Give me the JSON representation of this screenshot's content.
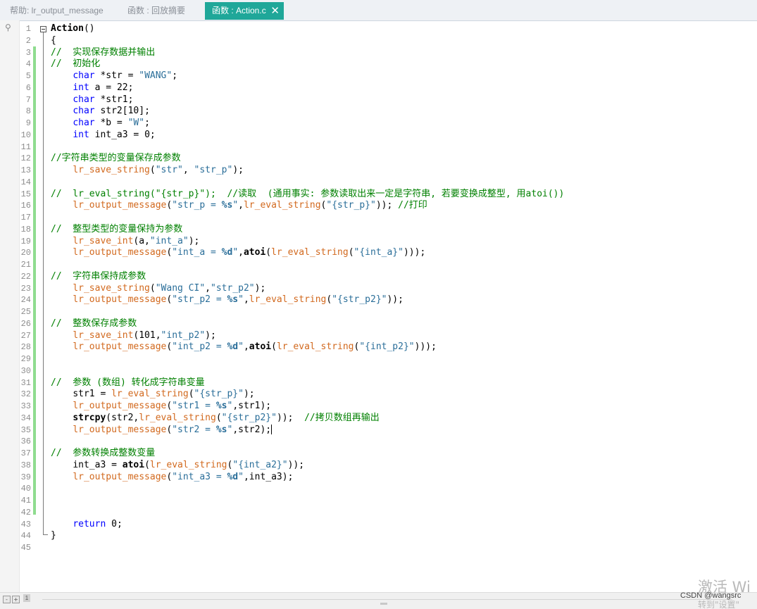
{
  "tabs": [
    {
      "label": "帮助: lr_output_message",
      "active": false
    },
    {
      "label": "函数 : 回放摘要",
      "active": false
    },
    {
      "label": "函数 : Action.c",
      "active": true
    }
  ],
  "line_numbers": [
    "1",
    "2",
    "3",
    "4",
    "5",
    "6",
    "7",
    "8",
    "9",
    "10",
    "11",
    "12",
    "13",
    "14",
    "15",
    "16",
    "17",
    "18",
    "19",
    "20",
    "21",
    "22",
    "23",
    "24",
    "25",
    "26",
    "27",
    "28",
    "29",
    "30",
    "31",
    "32",
    "33",
    "34",
    "35",
    "36",
    "37",
    "38",
    "39",
    "40",
    "41",
    "42",
    "43",
    "44",
    "45"
  ],
  "code": {
    "l1_fn": "Action",
    "l1_rest": "()",
    "l2": "{",
    "l3_cmt": "//  实现保存数据并输出",
    "l4_cmt": "//  初始化",
    "l5_kw": "char",
    "l5_mid": " *str = ",
    "l5_str": "\"WANG\"",
    "l5_end": ";",
    "l6_kw": "int",
    "l6_mid": " a = ",
    "l6_num": "22",
    "l6_end": ";",
    "l7_kw": "char",
    "l7_rest": " *str1;",
    "l8_kw": "char",
    "l8_rest": " str2[10];",
    "l9_kw": "char",
    "l9_mid": " *b = ",
    "l9_str": "\"W\"",
    "l9_end": ";",
    "l10_kw": "int",
    "l10_mid": " int_a3 = ",
    "l10_num": "0",
    "l10_end": ";",
    "l12_cmt": "//字符串类型的变量保存成参数",
    "l13_fn": "lr_save_string",
    "l13_a": "(",
    "l13_s1": "\"str\"",
    "l13_b": ", ",
    "l13_s2": "\"str_p\"",
    "l13_c": ");",
    "l15_cmt": "//  lr_eval_string(\"{str_p}\");  //读取  (通用事实: 参数读取出来一定是字符串, 若要变换成整型, 用atoi())",
    "l16_fn": "lr_output_message",
    "l16_a": "(",
    "l16_s1a": "\"str_p = ",
    "l16_s1b": "%s",
    "l16_s1c": "\"",
    "l16_b": ",",
    "l16_fn2": "lr_eval_string",
    "l16_c": "(",
    "l16_s2": "\"{str_p}\"",
    "l16_d": ")); ",
    "l16_cmt": "//打印",
    "l18_cmt": "//  整型类型的变量保持为参数",
    "l19_fn": "lr_save_int",
    "l19_a": "(a,",
    "l19_s": "\"int_a\"",
    "l19_b": ");",
    "l20_fn": "lr_output_message",
    "l20_a": "(",
    "l20_s1a": "\"int_a = ",
    "l20_s1b": "%d",
    "l20_s1c": "\"",
    "l20_b": ",",
    "l20_fn2": "atoi",
    "l20_c": "(",
    "l20_fn3": "lr_eval_string",
    "l20_d": "(",
    "l20_s2": "\"{int_a}\"",
    "l20_e": ")));",
    "l22_cmt": "//  字符串保持成参数",
    "l23_fn": "lr_save_string",
    "l23_a": "(",
    "l23_s1": "\"Wang CI\"",
    "l23_b": ",",
    "l23_s2": "\"str_p2\"",
    "l23_c": ");",
    "l24_fn": "lr_output_message",
    "l24_a": "(",
    "l24_s1a": "\"str_p2 = ",
    "l24_s1b": "%s",
    "l24_s1c": "\"",
    "l24_b": ",",
    "l24_fn2": "lr_eval_string",
    "l24_c": "(",
    "l24_s2": "\"{str_p2}\"",
    "l24_d": "));",
    "l26_cmt": "//  整数保存成参数",
    "l27_fn": "lr_save_int",
    "l27_a": "(101,",
    "l27_s": "\"int_p2\"",
    "l27_b": ");",
    "l28_fn": "lr_output_message",
    "l28_a": "(",
    "l28_s1a": "\"int_p2 = ",
    "l28_s1b": "%d",
    "l28_s1c": "\"",
    "l28_b": ",",
    "l28_fn2": "atoi",
    "l28_c": "(",
    "l28_fn3": "lr_eval_string",
    "l28_d": "(",
    "l28_s2": "\"{int_p2}\"",
    "l28_e": ")));",
    "l31_cmt": "//  参数 (数组) 转化成字符串变量",
    "l32_a": "str1 = ",
    "l32_fn": "lr_eval_string",
    "l32_b": "(",
    "l32_s": "\"{str_p}\"",
    "l32_c": ");",
    "l33_fn": "lr_output_message",
    "l33_a": "(",
    "l33_s1a": "\"str1 = ",
    "l33_s1b": "%s",
    "l33_s1c": "\"",
    "l33_b": ",str1);",
    "l34_fn": "strcpy",
    "l34_a": "(str2,",
    "l34_fn2": "lr_eval_string",
    "l34_b": "(",
    "l34_s": "\"{str_p2}\"",
    "l34_c": "));  ",
    "l34_cmt": "//拷贝数组再输出",
    "l35_fn": "lr_output_message",
    "l35_a": "(",
    "l35_s1a": "\"str2 = ",
    "l35_s1b": "%s",
    "l35_s1c": "\"",
    "l35_b": ",str2);",
    "l37_cmt": "//  参数转换成整数变量",
    "l38_a": "int_a3 = ",
    "l38_fn": "atoi",
    "l38_b": "(",
    "l38_fn2": "lr_eval_string",
    "l38_c": "(",
    "l38_s": "\"{int_a2}\"",
    "l38_d": "));",
    "l39_fn": "lr_output_message",
    "l39_a": "(",
    "l39_s1a": "\"int_a3 = ",
    "l39_s1b": "%d",
    "l39_s1c": "\"",
    "l39_b": ",int_a3);",
    "l43_kw": "return",
    "l43_mid": " ",
    "l43_num": "0",
    "l43_end": ";",
    "l44": "}"
  },
  "statusbar": {
    "zoom_minus": "-",
    "zoom_plus": "+",
    "zoom_level": "1"
  },
  "overlay": {
    "activate_windows": "激活 Wi",
    "activate_windows_sub": "转到\"设置\"",
    "csdn_credit": "CSDN @wangsrc"
  }
}
